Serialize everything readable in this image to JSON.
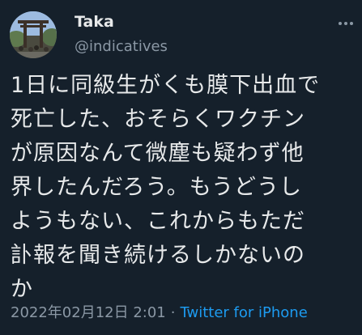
{
  "author": {
    "name": "Taka",
    "handle": "@indicatives",
    "avatar_icon": "torii-gate-photo-avatar"
  },
  "tweet": {
    "lines": [
      "1日に同級生がくも膜下出血で",
      "死亡した、おそらくワクチン",
      "が原因なんて微塵も疑わず他",
      "界したんだろう。もうどうし",
      "ようもない、これからもただ",
      "訃報を聞き続けるしかないの",
      "か"
    ]
  },
  "meta": {
    "timestamp": "2022年02月12日 2:01",
    "separator": "·",
    "source": "Twitter for iPhone"
  },
  "colors": {
    "background": "#15202b",
    "text": "#e7e9ea",
    "secondary": "#8b98a5",
    "accent": "#1d9bf0"
  },
  "icons": {
    "more": "more-dots-icon"
  }
}
